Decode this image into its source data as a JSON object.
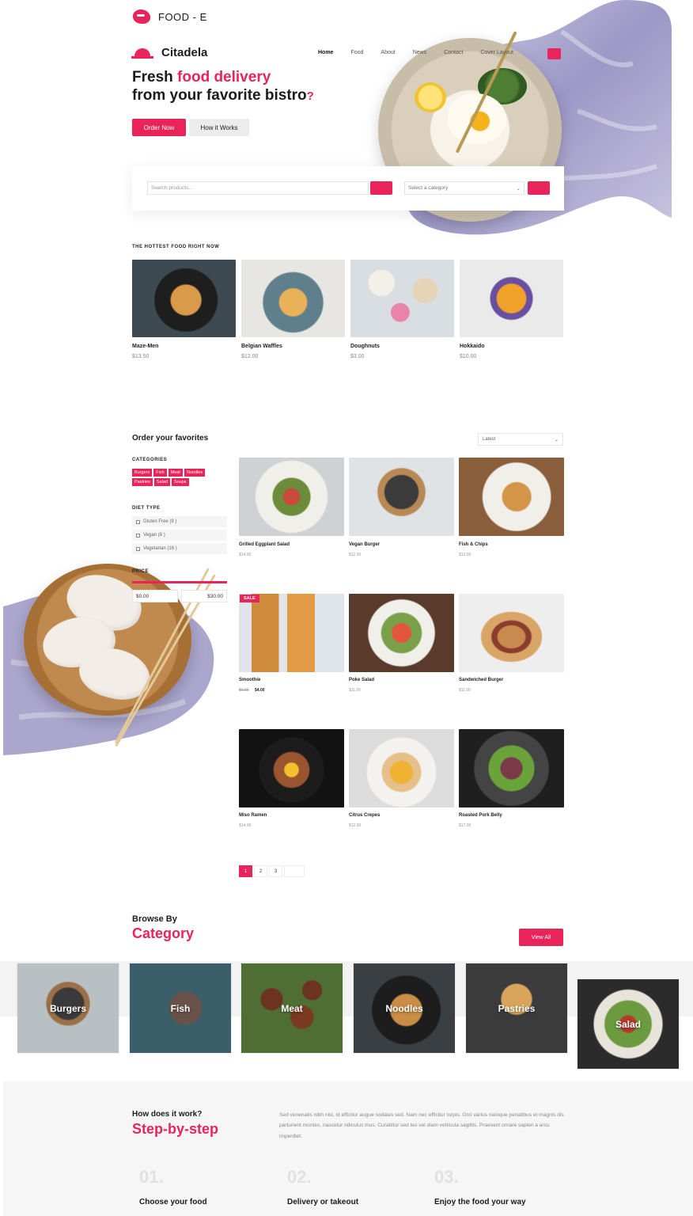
{
  "brand": {
    "top_name": "FOOD - E",
    "site_name": "Citadela"
  },
  "nav": {
    "items": [
      "Home",
      "Food",
      "About",
      "News",
      "Contact",
      "Cover Layout"
    ]
  },
  "hero": {
    "title_plain": "Fresh ",
    "title_highlight": "food delivery",
    "subtitle": "from your favorite bistro",
    "subtitle_mark": "?",
    "order_btn": "Order Now",
    "how_btn": "How it Works"
  },
  "search": {
    "placeholder": "Search products...",
    "category_placeholder": "Select a category"
  },
  "hottest": {
    "label": "THE HOTTEST FOOD RIGHT NOW",
    "items": [
      {
        "name": "Maze-Men",
        "price": "$13.50"
      },
      {
        "name": "Belgian Waffles",
        "price": "$12.00"
      },
      {
        "name": "Doughnuts",
        "price": "$3.00"
      },
      {
        "name": "Hokkaido",
        "price": "$10.00"
      }
    ]
  },
  "favorites": {
    "title": "Order your favorites",
    "sort": "Latest",
    "categories_label": "CATEGORIES",
    "tags": [
      "Burgers",
      "Fish",
      "Meat",
      "Noodles",
      "Pastries",
      "Salad",
      "Soups"
    ],
    "diet_label": "DIET TYPE",
    "diets": [
      "Gluten Free (9 )",
      "Vegan (8 )",
      "Vegetarian (16 )"
    ],
    "price_label": "PRICE",
    "price_min": "$0.00",
    "price_max": "$30.00",
    "sale_badge": "SALE",
    "products": [
      {
        "name": "Grilled Eggplant Salad",
        "price": "$14.00",
        "old_price": ""
      },
      {
        "name": "Vegan Burger",
        "price": "$12.00",
        "old_price": ""
      },
      {
        "name": "Fish & Chips",
        "price": "$13.00",
        "old_price": ""
      },
      {
        "name": "Smoothie",
        "price": "$4.00",
        "old_price": "$6.00"
      },
      {
        "name": "Poke Salad",
        "price": "$11.00",
        "old_price": ""
      },
      {
        "name": "Sandwiched Burger",
        "price": "$11.00",
        "old_price": ""
      },
      {
        "name": "Miso Ramen",
        "price": "$14.00",
        "old_price": ""
      },
      {
        "name": "Citrus Crepes",
        "price": "$12.00",
        "old_price": ""
      },
      {
        "name": "Roasted Pork Belly",
        "price": "$17.00",
        "old_price": ""
      }
    ],
    "pages": [
      "1",
      "2",
      "3",
      ""
    ]
  },
  "browse": {
    "small": "Browse By",
    "big": "Category",
    "view_all": "View All",
    "categories": [
      "Burgers",
      "Fish",
      "Meat",
      "Noodles",
      "Pastries",
      "Salad"
    ]
  },
  "how": {
    "small": "How does it work?",
    "big": "Step-by-step",
    "paragraph": "Sed venenatis nibh nisl, id efficitur augue sodales sed. Nam nec efficitur turpis. Orci varius natoque penatibus et magnis dis parturient montes, nascetur ridiculus mus. Curabitur sed leo vel diam vehicula sagittis. Praesent ornare sapien a arcu imperdiet.",
    "steps": [
      {
        "num": "01.",
        "title": "Choose your food"
      },
      {
        "num": "02.",
        "title": "Delivery or takeout"
      },
      {
        "num": "03.",
        "title": "Enjoy the food your way"
      }
    ]
  },
  "colors": {
    "accent": "#e8245a",
    "wash": "#8e88b8",
    "light_bg": "#f7f6f6"
  }
}
